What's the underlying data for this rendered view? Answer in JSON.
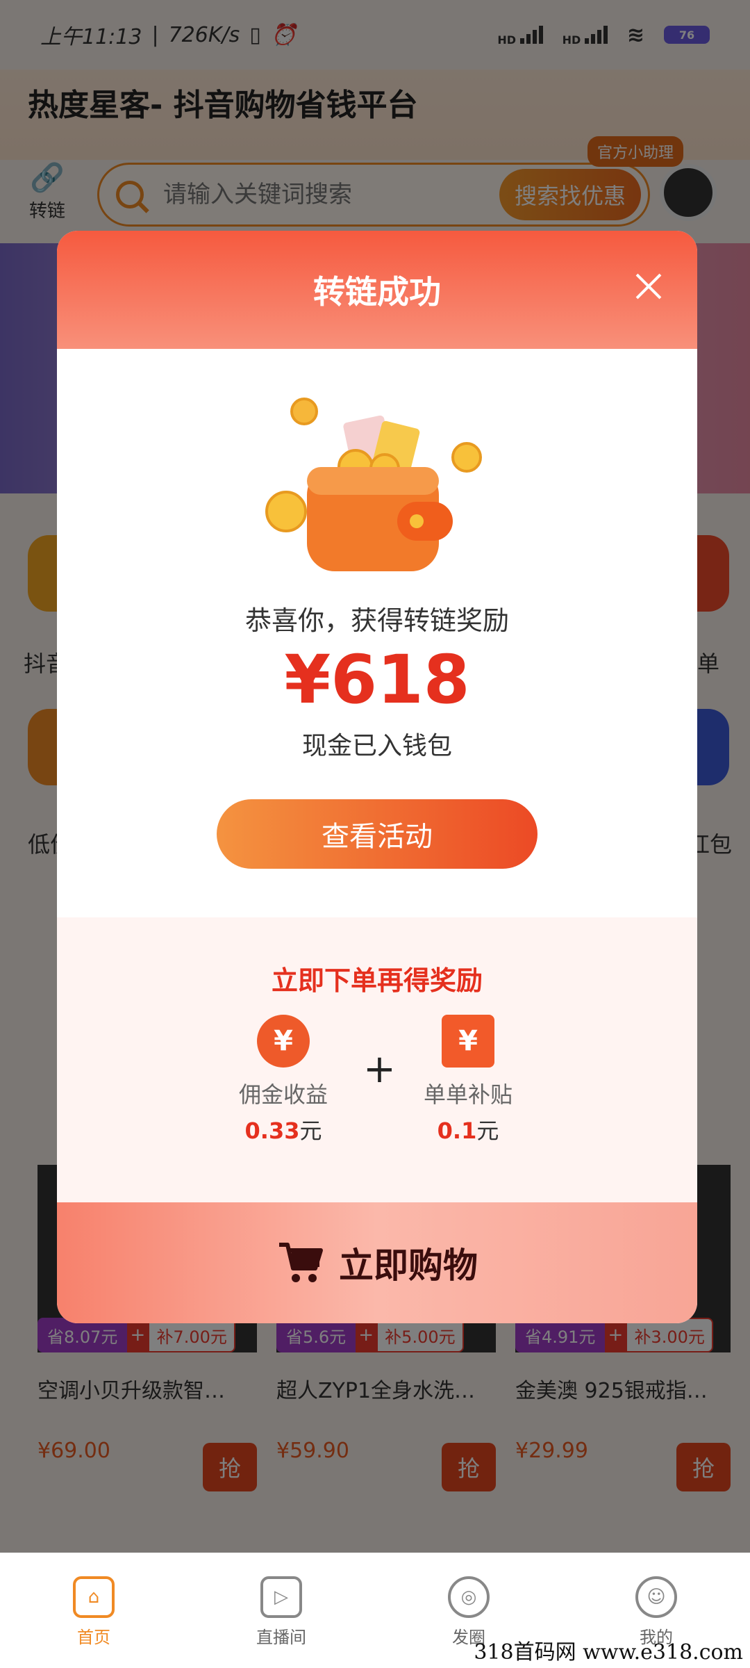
{
  "status": {
    "time": "上午11:13",
    "speed": "726K/s",
    "sig1": "HD",
    "sig2": "HD",
    "battery": "76"
  },
  "header": {
    "title": "热度星客- 抖音购物省钱平台",
    "link_label": "转链",
    "search_placeholder": "请输入关键词搜索",
    "search_button": "搜索找优惠",
    "helper_badge": "官方小助理"
  },
  "categories": [
    "抖音",
    "单",
    "低价",
    "红包"
  ],
  "products": [
    {
      "save": "省8.07元",
      "subsidy": "补7.00元",
      "title": "空调小贝升级款智…",
      "price": "¥69.00",
      "grab": "抢"
    },
    {
      "save": "省5.6元",
      "subsidy": "补5.00元",
      "title": "超人ZYP1全身水洗…",
      "price": "¥59.90",
      "grab": "抢"
    },
    {
      "save": "省4.91元",
      "subsidy": "补3.00元",
      "title": "金美澳 925银戒指…",
      "price": "¥29.99",
      "grab": "抢"
    }
  ],
  "tabs": [
    {
      "label": "首页",
      "icon": "home-icon"
    },
    {
      "label": "直播间",
      "icon": "live-icon"
    },
    {
      "label": "发圈",
      "icon": "aperture-icon"
    },
    {
      "label": "我的",
      "icon": "profile-icon"
    }
  ],
  "modal": {
    "title": "转链成功",
    "congrats": "恭喜你，获得转链奖励",
    "amount": "¥618",
    "amount_sub": "现金已入钱包",
    "view_button": "查看活动",
    "reward_heading": "立即下单再得奖励",
    "reward1": {
      "label": "佣金收益",
      "value": "0.33",
      "unit": "元",
      "icon": "yuan-coin-icon"
    },
    "reward2": {
      "label": "单单补贴",
      "value": "0.1",
      "unit": "元",
      "icon": "yuan-ticket-icon"
    },
    "shop_button": "立即购物"
  },
  "watermark": "318首码网  www.e318.com",
  "colors": {
    "accent": "#f08a24",
    "modal_red": "#e5301e",
    "head_red": "#f65a3f"
  }
}
